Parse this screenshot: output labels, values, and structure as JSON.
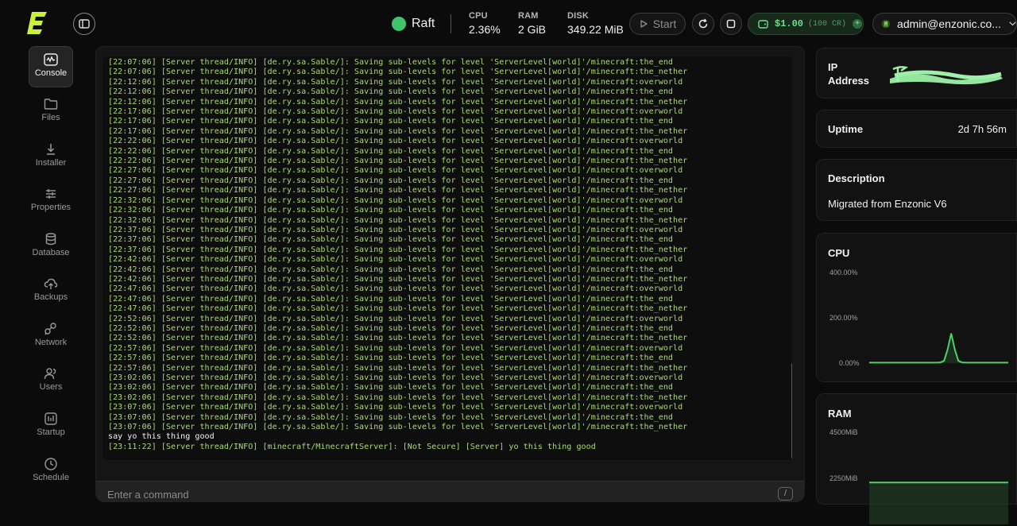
{
  "header": {
    "server_name": "Raft",
    "stats": [
      {
        "label": "CPU",
        "value": "2.36%"
      },
      {
        "label": "RAM",
        "value": "2 GiB"
      },
      {
        "label": "DISK",
        "value": "349.22 MiB"
      }
    ],
    "start_label": "Start",
    "credit_amount": "$1.00",
    "credit_cr": "(100 CR)",
    "user_email": "admin@enzonic.co...",
    "colors": {
      "online": "#3ec46a",
      "accent": "#c8f03c"
    }
  },
  "sidebar": {
    "items": [
      {
        "label": "Console",
        "icon": "console-icon",
        "active": true
      },
      {
        "label": "Files",
        "icon": "folder-icon"
      },
      {
        "label": "Installer",
        "icon": "download-icon"
      },
      {
        "label": "Properties",
        "icon": "sliders-icon"
      },
      {
        "label": "Database",
        "icon": "database-icon"
      },
      {
        "label": "Backups",
        "icon": "cloud-upload-icon"
      },
      {
        "label": "Network",
        "icon": "network-icon"
      },
      {
        "label": "Users",
        "icon": "users-icon"
      },
      {
        "label": "Startup",
        "icon": "startup-icon"
      },
      {
        "label": "Schedule",
        "icon": "clock-icon"
      }
    ]
  },
  "console": {
    "lines": [
      "[22:07:06] [Server thread/INFO] [de.ry.sa.Sable/]: Saving sub-levels for level 'ServerLevel[world]'/minecraft:the_end",
      "[22:07:06] [Server thread/INFO] [de.ry.sa.Sable/]: Saving sub-levels for level 'ServerLevel[world]'/minecraft:the_nether",
      "[22:12:06] [Server thread/INFO] [de.ry.sa.Sable/]: Saving sub-levels for level 'ServerLevel[world]'/minecraft:overworld",
      "[22:12:06] [Server thread/INFO] [de.ry.sa.Sable/]: Saving sub-levels for level 'ServerLevel[world]'/minecraft:the_end",
      "[22:12:06] [Server thread/INFO] [de.ry.sa.Sable/]: Saving sub-levels for level 'ServerLevel[world]'/minecraft:the_nether",
      "[22:17:06] [Server thread/INFO] [de.ry.sa.Sable/]: Saving sub-levels for level 'ServerLevel[world]'/minecraft:overworld",
      "[22:17:06] [Server thread/INFO] [de.ry.sa.Sable/]: Saving sub-levels for level 'ServerLevel[world]'/minecraft:the_end",
      "[22:17:06] [Server thread/INFO] [de.ry.sa.Sable/]: Saving sub-levels for level 'ServerLevel[world]'/minecraft:the_nether",
      "[22:22:06] [Server thread/INFO] [de.ry.sa.Sable/]: Saving sub-levels for level 'ServerLevel[world]'/minecraft:overworld",
      "[22:22:06] [Server thread/INFO] [de.ry.sa.Sable/]: Saving sub-levels for level 'ServerLevel[world]'/minecraft:the_end",
      "[22:22:06] [Server thread/INFO] [de.ry.sa.Sable/]: Saving sub-levels for level 'ServerLevel[world]'/minecraft:the_nether",
      "[22:27:06] [Server thread/INFO] [de.ry.sa.Sable/]: Saving sub-levels for level 'ServerLevel[world]'/minecraft:overworld",
      "[22:27:06] [Server thread/INFO] [de.ry.sa.Sable/]: Saving sub-levels for level 'ServerLevel[world]'/minecraft:the_end",
      "[22:27:06] [Server thread/INFO] [de.ry.sa.Sable/]: Saving sub-levels for level 'ServerLevel[world]'/minecraft:the_nether",
      "[22:32:06] [Server thread/INFO] [de.ry.sa.Sable/]: Saving sub-levels for level 'ServerLevel[world]'/minecraft:overworld",
      "[22:32:06] [Server thread/INFO] [de.ry.sa.Sable/]: Saving sub-levels for level 'ServerLevel[world]'/minecraft:the_end",
      "[22:32:06] [Server thread/INFO] [de.ry.sa.Sable/]: Saving sub-levels for level 'ServerLevel[world]'/minecraft:the_nether",
      "[22:37:06] [Server thread/INFO] [de.ry.sa.Sable/]: Saving sub-levels for level 'ServerLevel[world]'/minecraft:overworld",
      "[22:37:06] [Server thread/INFO] [de.ry.sa.Sable/]: Saving sub-levels for level 'ServerLevel[world]'/minecraft:the_end",
      "[22:37:06] [Server thread/INFO] [de.ry.sa.Sable/]: Saving sub-levels for level 'ServerLevel[world]'/minecraft:the_nether",
      "[22:42:06] [Server thread/INFO] [de.ry.sa.Sable/]: Saving sub-levels for level 'ServerLevel[world]'/minecraft:overworld",
      "[22:42:06] [Server thread/INFO] [de.ry.sa.Sable/]: Saving sub-levels for level 'ServerLevel[world]'/minecraft:the_end",
      "[22:42:06] [Server thread/INFO] [de.ry.sa.Sable/]: Saving sub-levels for level 'ServerLevel[world]'/minecraft:the_nether",
      "[22:47:06] [Server thread/INFO] [de.ry.sa.Sable/]: Saving sub-levels for level 'ServerLevel[world]'/minecraft:overworld",
      "[22:47:06] [Server thread/INFO] [de.ry.sa.Sable/]: Saving sub-levels for level 'ServerLevel[world]'/minecraft:the_end",
      "[22:47:06] [Server thread/INFO] [de.ry.sa.Sable/]: Saving sub-levels for level 'ServerLevel[world]'/minecraft:the_nether",
      "[22:52:06] [Server thread/INFO] [de.ry.sa.Sable/]: Saving sub-levels for level 'ServerLevel[world]'/minecraft:overworld",
      "[22:52:06] [Server thread/INFO] [de.ry.sa.Sable/]: Saving sub-levels for level 'ServerLevel[world]'/minecraft:the_end",
      "[22:52:06] [Server thread/INFO] [de.ry.sa.Sable/]: Saving sub-levels for level 'ServerLevel[world]'/minecraft:the_nether",
      "[22:57:06] [Server thread/INFO] [de.ry.sa.Sable/]: Saving sub-levels for level 'ServerLevel[world]'/minecraft:overworld",
      "[22:57:06] [Server thread/INFO] [de.ry.sa.Sable/]: Saving sub-levels for level 'ServerLevel[world]'/minecraft:the_end",
      "[22:57:06] [Server thread/INFO] [de.ry.sa.Sable/]: Saving sub-levels for level 'ServerLevel[world]'/minecraft:the_nether",
      "[23:02:06] [Server thread/INFO] [de.ry.sa.Sable/]: Saving sub-levels for level 'ServerLevel[world]'/minecraft:overworld",
      "[23:02:06] [Server thread/INFO] [de.ry.sa.Sable/]: Saving sub-levels for level 'ServerLevel[world]'/minecraft:the_end",
      "[23:02:06] [Server thread/INFO] [de.ry.sa.Sable/]: Saving sub-levels for level 'ServerLevel[world]'/minecraft:the_nether",
      "[23:07:06] [Server thread/INFO] [de.ry.sa.Sable/]: Saving sub-levels for level 'ServerLevel[world]'/minecraft:overworld",
      "[23:07:06] [Server thread/INFO] [de.ry.sa.Sable/]: Saving sub-levels for level 'ServerLevel[world]'/minecraft:the_end",
      "[23:07:06] [Server thread/INFO] [de.ry.sa.Sable/]: Saving sub-levels for level 'ServerLevel[world]'/minecraft:the_nether",
      "say yo this thing good",
      "[23:11:22] [Server thread/INFO] [minecraft/MinecraftServer]: [Not Secure] [Server] yo this thing good"
    ],
    "user_line_index": 38,
    "command_placeholder": "Enter a command",
    "slash_label": "/"
  },
  "info": {
    "ip_label": "IP Address",
    "uptime_label": "Uptime",
    "uptime_value": "2d 7h 56m",
    "description_label": "Description",
    "description_value": "Migrated from Enzonic V6"
  },
  "cpu_card": {
    "title": "CPU",
    "ticks": [
      "400.00%",
      "200.00%",
      "0.00%"
    ],
    "chart_data": {
      "type": "area",
      "ylim": [
        0,
        400
      ],
      "values": [
        2,
        2,
        2,
        2,
        2,
        2,
        2,
        2,
        2,
        2,
        2,
        2,
        2,
        2,
        2,
        2,
        2,
        2,
        2,
        2,
        3,
        10,
        60,
        130,
        60,
        10,
        3,
        2,
        2,
        2,
        2,
        2,
        2,
        2,
        2,
        2,
        2,
        2,
        2,
        2
      ]
    }
  },
  "ram_card": {
    "title": "RAM",
    "ticks": [
      "4500MiB",
      "2250MiB"
    ],
    "chart_data": {
      "type": "area",
      "ylim": [
        0,
        4500
      ],
      "values": [
        2048,
        2048,
        2048,
        2048,
        2048,
        2048,
        2048,
        2048,
        2048,
        2048,
        2048,
        2048,
        2048,
        2048,
        2048,
        2048,
        2048,
        2048,
        2048,
        2048
      ]
    }
  }
}
